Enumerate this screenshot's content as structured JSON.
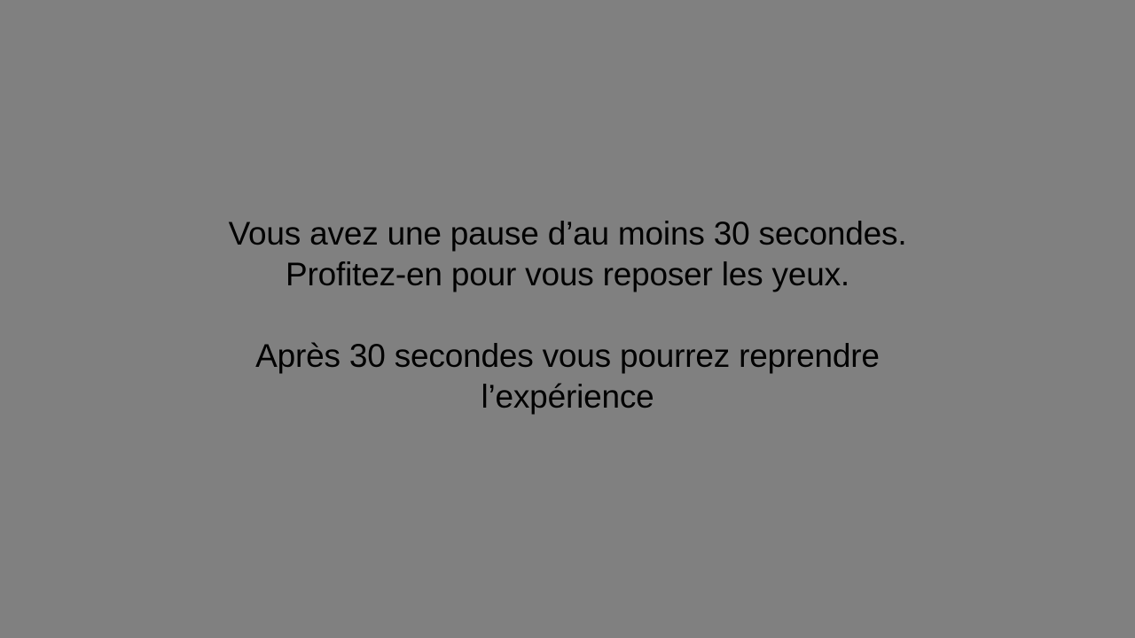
{
  "screen": {
    "background_color": "#808080",
    "text_color": "#000000"
  },
  "message": {
    "line1": "Vous avez une pause d’au moins 30 secondes.",
    "line2": "Profitez-en pour vous reposer les yeux.",
    "line3": "Après 30 secondes vous pourrez reprendre",
    "line4": "l’expérience"
  }
}
